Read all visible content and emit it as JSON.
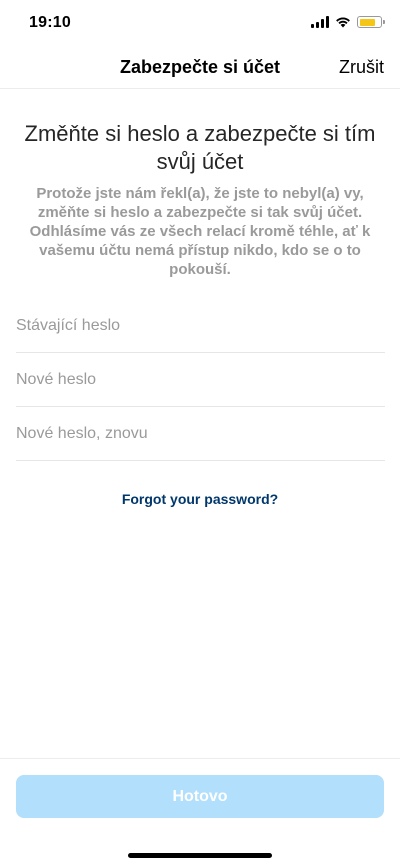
{
  "status": {
    "time": "19:10",
    "battery_color": "#f5c518",
    "battery_level": 0.75,
    "icons": [
      "cellular-signal-icon",
      "wifi-icon",
      "battery-icon"
    ]
  },
  "nav": {
    "title": "Zabezpečte si účet",
    "cancel_label": "Zrušit"
  },
  "content": {
    "headline": "Změňte si heslo a zabezpečte si tím svůj účet",
    "description": "Protože jste nám řekl(a), že jste to nebyl(a) vy, změňte si heslo a zabezpečte si tak svůj účet. Odhlásíme vás ze všech relací kromě téhle, ať k vašemu účtu nemá přístup nikdo, kdo se o to pokouší."
  },
  "form": {
    "current_password": {
      "placeholder": "Stávající heslo",
      "value": ""
    },
    "new_password": {
      "placeholder": "Nové heslo",
      "value": ""
    },
    "new_password_again": {
      "placeholder": "Nové heslo, znovu",
      "value": ""
    },
    "forgot_label": "Forgot your password?"
  },
  "footer": {
    "done_label": "Hotovo",
    "done_enabled": false
  },
  "colors": {
    "link": "#00376b",
    "button_disabled_bg": "#b2dffc",
    "muted_text": "#9a9a9a"
  }
}
